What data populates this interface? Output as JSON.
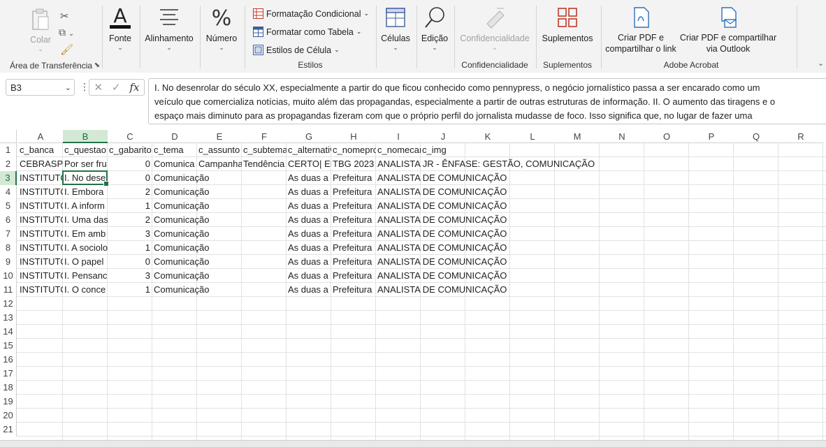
{
  "ribbon": {
    "clipboard": {
      "paste_label": "Colar",
      "group_label": "Área de Transferência"
    },
    "font": {
      "label": "Fonte"
    },
    "alignment": {
      "label": "Alinhamento"
    },
    "number": {
      "label": "Número"
    },
    "styles": {
      "conditional_label": "Formatação Condicional",
      "table_label": "Formatar como Tabela",
      "cell_styles_label": "Estilos de Célula",
      "group_label": "Estilos"
    },
    "cells": {
      "label": "Células"
    },
    "editing": {
      "label": "Edição"
    },
    "sensitivity": {
      "button_label": "Confidencialidade",
      "group_label": "Confidencialidade"
    },
    "addins": {
      "button_label": "Suplementos",
      "group_label": "Suplementos"
    },
    "acrobat": {
      "pdf_link_line1": "Criar PDF e",
      "pdf_link_line2": "compartilhar o link",
      "pdf_outlook_line1": "Criar PDF e compartilhar",
      "pdf_outlook_line2": "via Outlook",
      "group_label": "Adobe Acrobat"
    }
  },
  "formula_bar": {
    "name_box": "B3",
    "fx_label": "fx",
    "content_lines": [
      "I. No desenrolar do século XX, especialmente a partir do que ficou conhecido como pennypress, o negócio jornalístico passa a ser encarado como um",
      "veículo que comercializa notícias, muito além das propagandas, especialmente a partir de outras estruturas de informação. II. O aumento das tiragens e o",
      "espaço mais diminuto para as propagandas fizeram com que o próprio perfil do jornalista mudasse de foco. Isso significa que, no lugar de fazer uma"
    ]
  },
  "grid": {
    "columns": [
      "A",
      "B",
      "C",
      "D",
      "E",
      "F",
      "G",
      "H",
      "I",
      "J",
      "K",
      "L",
      "M",
      "N",
      "O",
      "P",
      "Q",
      "R"
    ],
    "selected_column": "B",
    "selected_row": "3",
    "rows": [
      {
        "num": "1",
        "cells": [
          "c_banca",
          "c_questao",
          "c_gabarito",
          "c_tema",
          "c_assunto",
          "c_subtema",
          "c_alternativas",
          "c_nomeprova",
          "c_nomecargo",
          "c_img"
        ]
      },
      {
        "num": "2",
        "cells": [
          "CEBRASPE",
          "Por ser fru",
          "0",
          "Comunica",
          "Campanha",
          "Tendência",
          "CERTO| ERRADO",
          "TBG 2023",
          "ANALISTA JR - ÊNFASE: GESTÃO, COMUNICAÇÃO",
          ""
        ]
      },
      {
        "num": "3",
        "cells": [
          "INSTITUTO",
          "I. No dese",
          "0",
          "Comunicação",
          "",
          "",
          "As duas a",
          "Prefeitura",
          "ANALISTA DE COMUNICAÇÃO",
          ""
        ]
      },
      {
        "num": "4",
        "cells": [
          "INSTITUTO",
          "I. Embora",
          "2",
          "Comunicação",
          "",
          "",
          "As duas a",
          "Prefeitura",
          "ANALISTA DE COMUNICAÇÃO",
          ""
        ]
      },
      {
        "num": "5",
        "cells": [
          "INSTITUTO",
          "I. A inform",
          "1",
          "Comunicação",
          "",
          "",
          "As duas a",
          "Prefeitura",
          "ANALISTA DE COMUNICAÇÃO",
          ""
        ]
      },
      {
        "num": "6",
        "cells": [
          "INSTITUTO",
          "I. Uma das",
          "2",
          "Comunicação",
          "",
          "",
          "As duas a",
          "Prefeitura",
          "ANALISTA DE COMUNICAÇÃO",
          ""
        ]
      },
      {
        "num": "7",
        "cells": [
          "INSTITUTO",
          "I. Em amb",
          "3",
          "Comunicação",
          "",
          "",
          "As duas a",
          "Prefeitura",
          "ANALISTA DE COMUNICAÇÃO",
          ""
        ]
      },
      {
        "num": "8",
        "cells": [
          "INSTITUTO",
          "I. A sociolo",
          "1",
          "Comunicação",
          "",
          "",
          "As duas a",
          "Prefeitura",
          "ANALISTA DE COMUNICAÇÃO",
          ""
        ]
      },
      {
        "num": "9",
        "cells": [
          "INSTITUTO",
          "I. O papel",
          "0",
          "Comunicação",
          "",
          "",
          "As duas a",
          "Prefeitura",
          "ANALISTA DE COMUNICAÇÃO",
          ""
        ]
      },
      {
        "num": "10",
        "cells": [
          "INSTITUTO",
          "I. Pensanc",
          "3",
          "Comunicação",
          "",
          "",
          "As duas a",
          "Prefeitura",
          "ANALISTA DE COMUNICAÇÃO",
          ""
        ]
      },
      {
        "num": "11",
        "cells": [
          "INSTITUTO",
          "I. O conce",
          "1",
          "Comunicação",
          "",
          "",
          "As duas a",
          "Prefeitura",
          "ANALISTA DE COMUNICAÇÃO",
          ""
        ]
      },
      {
        "num": "12",
        "cells": []
      },
      {
        "num": "13",
        "cells": []
      },
      {
        "num": "14",
        "cells": []
      },
      {
        "num": "15",
        "cells": []
      },
      {
        "num": "16",
        "cells": []
      },
      {
        "num": "17",
        "cells": []
      },
      {
        "num": "18",
        "cells": []
      },
      {
        "num": "19",
        "cells": []
      },
      {
        "num": "20",
        "cells": []
      },
      {
        "num": "21",
        "cells": []
      }
    ]
  },
  "colors": {
    "accent": "#217346",
    "header_selected_bg": "#d3e9d6",
    "styles_icon": "#c0392b"
  }
}
